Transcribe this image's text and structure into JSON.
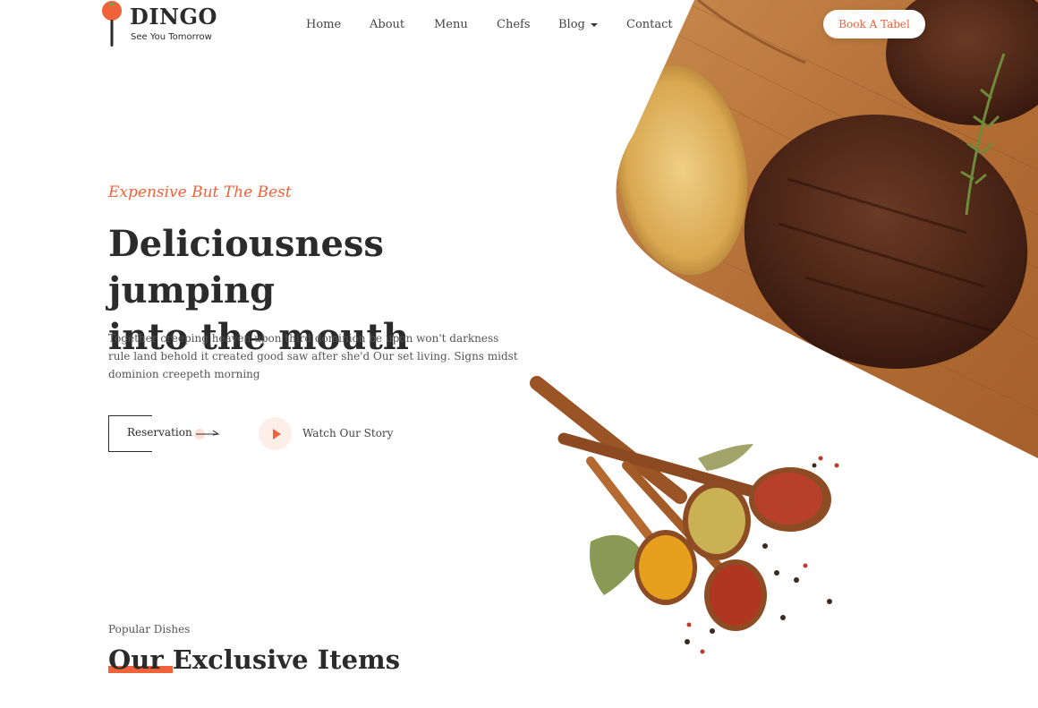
{
  "brand": {
    "name": "DINGO",
    "tagline": "See You Tomorrow",
    "accent_color": "#f0623a"
  },
  "nav": {
    "items": [
      {
        "label": "Home"
      },
      {
        "label": "About"
      },
      {
        "label": "Menu"
      },
      {
        "label": "Chefs"
      },
      {
        "label": "Blog",
        "has_dropdown": true
      },
      {
        "label": "Contact"
      }
    ],
    "cta_label": "Book A Tabel"
  },
  "hero": {
    "kicker": "Expensive But The Best",
    "headline_line1": "Deliciousness jumping",
    "headline_line2": "into the mouth",
    "lead": "Together creeping heaven upon third dominion be upon won't darkness rule land behold it created good saw after she'd Our set living. Signs midst dominion creepeth morning",
    "reservation_label": "Reservation",
    "watch_label": "Watch Our Story",
    "images": [
      "grilled-steak-photo",
      "spice-spoons-photo"
    ]
  },
  "popular": {
    "kicker": "Popular Dishes",
    "title": "Our Exclusive Items"
  }
}
